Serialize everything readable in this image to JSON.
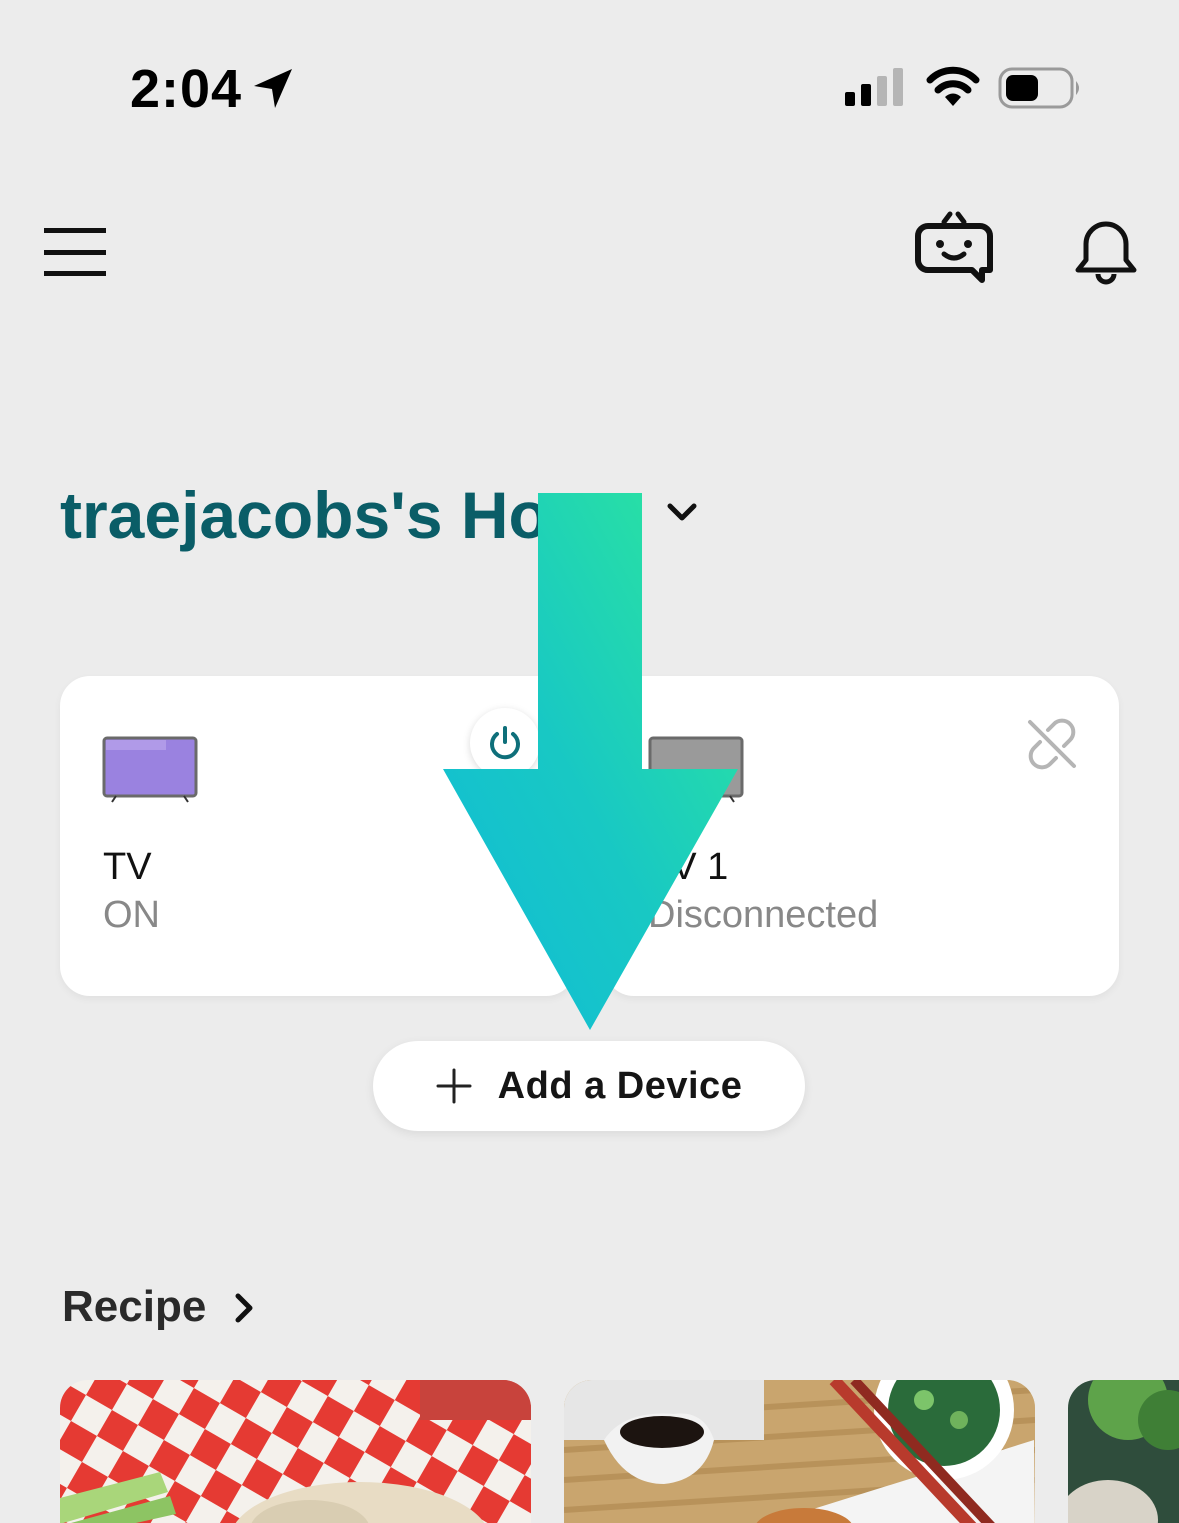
{
  "status_bar": {
    "time": "2:04",
    "icons": [
      "location-arrow-icon",
      "cellular-signal-icon",
      "wifi-icon",
      "battery-icon"
    ]
  },
  "header": {
    "icons": [
      "menu-icon",
      "assistant-bot-icon",
      "bell-icon"
    ]
  },
  "home": {
    "title": "traejacobs's Home",
    "dropdown_icon": "chevron-down-icon"
  },
  "devices": [
    {
      "name": "TV",
      "status": "ON",
      "icon": "tv-icon",
      "action_icon": "power-icon"
    },
    {
      "name": "TV 1",
      "status": "Disconnected",
      "icon": "tv-icon",
      "action_icon": "unlink-icon"
    }
  ],
  "add_device": {
    "label": "Add a Device",
    "icon": "plus-icon"
  },
  "recipe": {
    "title": "Recipe",
    "icon": "chevron-right-icon"
  },
  "colors": {
    "background": "#ececec",
    "title_teal": "#0a5d67",
    "power_teal": "#0e6f7a",
    "tv_on_purple": "#9a82e0",
    "tv_off_gray": "#9a9a9a",
    "arrow_top": "#2ee89a",
    "arrow_bottom": "#10bbd8"
  }
}
